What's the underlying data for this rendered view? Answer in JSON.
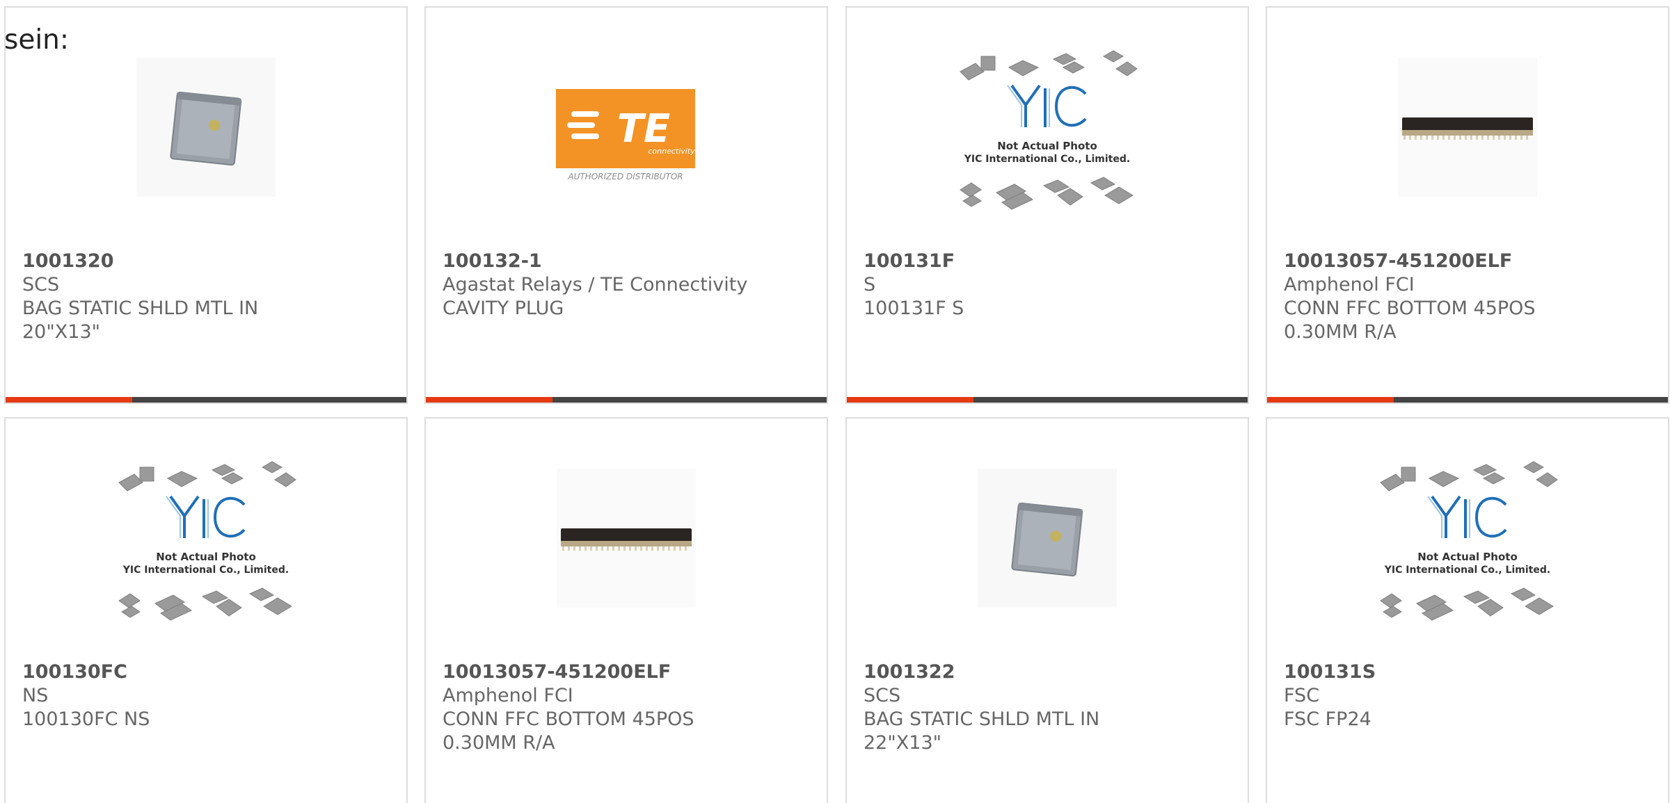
{
  "heading": "sein:",
  "colors": {
    "accent": "#e63a12",
    "bar": "#444444",
    "border": "#dddddd",
    "text": "#666666"
  },
  "products": [
    {
      "part_number": "1001320",
      "brand": "SCS",
      "desc1": "BAG STATIC SHLD MTL IN",
      "desc2": "20\"X13\"",
      "image": "static-bag-image"
    },
    {
      "part_number": "100132-1",
      "brand": "Agastat Relays / TE Connectivity",
      "desc1": "CAVITY PLUG",
      "desc2": "",
      "image": "te-logo-image",
      "logo_text": "TE",
      "logo_sub": "connectivity",
      "logo_caption": "AUTHORIZED DISTRIBUTOR"
    },
    {
      "part_number": "100131F",
      "brand": "S",
      "desc1": "100131F S",
      "desc2": "",
      "image": "yic-placeholder-image",
      "placeholder_line1": "Not Actual Photo",
      "placeholder_line2": "YIC International Co., Limited."
    },
    {
      "part_number": "10013057-451200ELF",
      "brand": "Amphenol FCI",
      "desc1": "CONN FFC BOTTOM 45POS",
      "desc2": "0.30MM R/A",
      "image": "connector-image"
    },
    {
      "part_number": "100130FC",
      "brand": "NS",
      "desc1": "100130FC NS",
      "desc2": "",
      "image": "yic-placeholder-image",
      "placeholder_line1": "Not Actual Photo",
      "placeholder_line2": "YIC International Co., Limited."
    },
    {
      "part_number": "10013057-451200ELF",
      "brand": "Amphenol FCI",
      "desc1": "CONN FFC BOTTOM 45POS",
      "desc2": "0.30MM R/A",
      "image": "connector-image"
    },
    {
      "part_number": "1001322",
      "brand": "SCS",
      "desc1": "BAG STATIC SHLD MTL IN",
      "desc2": "22\"X13\"",
      "image": "static-bag-image"
    },
    {
      "part_number": "100131S",
      "brand": "FSC",
      "desc1": "FSC FP24",
      "desc2": "",
      "image": "yic-placeholder-image",
      "placeholder_line1": "Not Actual Photo",
      "placeholder_line2": "YIC International Co., Limited."
    }
  ]
}
